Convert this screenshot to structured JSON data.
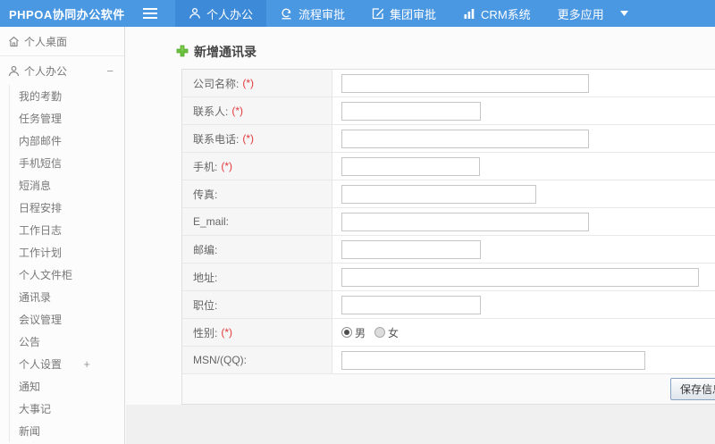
{
  "app": {
    "title": "PHPOA协同办公软件"
  },
  "header": {
    "hamburger_icon": "menu-icon",
    "nav": [
      {
        "label": "个人办公",
        "icon": "person-icon",
        "active": true
      },
      {
        "label": "流程审批",
        "icon": "process-icon",
        "active": false
      },
      {
        "label": "集团审批",
        "icon": "edit-icon",
        "active": false
      },
      {
        "label": "CRM系统",
        "icon": "chart-icon",
        "active": false
      },
      {
        "label": "更多应用",
        "icon": "caret-down-icon",
        "active": false,
        "caret": true
      }
    ]
  },
  "sidebar": {
    "desktop_item": {
      "label": "个人桌面",
      "icon": "home-icon"
    },
    "group_item": {
      "label": "个人办公",
      "icon": "person-icon",
      "collapse_symbol": "−"
    },
    "sub_items": [
      "我的考勤",
      "任务管理",
      "内部邮件",
      "手机短信",
      "短消息",
      "日程安排",
      "工作日志",
      "工作计划",
      "个人文件柜",
      "通讯录",
      "会议管理",
      "公告"
    ],
    "settings_item": {
      "label": "个人设置",
      "expand_symbol": "+"
    },
    "extra_items": [
      "通知",
      "大事记",
      "新闻"
    ]
  },
  "main": {
    "title": "新增通讯录",
    "title_icon": "plus-icon",
    "required_mark": "(*)",
    "form_rows": [
      {
        "label": "公司名称:",
        "required": true,
        "type": "text",
        "input_width": 277
      },
      {
        "label": "联系人:",
        "required": true,
        "type": "text",
        "input_width": 156
      },
      {
        "label": "联系电话:",
        "required": true,
        "type": "text",
        "input_width": 277
      },
      {
        "label": "手机:",
        "required": true,
        "type": "text",
        "input_width": 155
      },
      {
        "label": "传真:",
        "required": false,
        "type": "text",
        "input_width": 218
      },
      {
        "label": "E_mail:",
        "required": false,
        "type": "text",
        "input_width": 277
      },
      {
        "label": "邮编:",
        "required": false,
        "type": "text",
        "input_width": 156
      },
      {
        "label": "地址:",
        "required": false,
        "type": "text",
        "input_width": 400
      },
      {
        "label": "职位:",
        "required": false,
        "type": "text",
        "input_width": 156
      },
      {
        "label": "性别:",
        "required": true,
        "type": "radio",
        "options": [
          {
            "label": "男",
            "checked": true
          },
          {
            "label": "女",
            "checked": false
          }
        ]
      },
      {
        "label": "MSN/(QQ):",
        "required": false,
        "type": "text",
        "input_width": 340
      }
    ],
    "save_label": "保存信息"
  },
  "colors": {
    "header_bg": "#4a97e2",
    "header_active_bg": "#3c8ad8",
    "accent_green": "#6abf3f",
    "required_red": "#e4393c",
    "label_cell_bg": "#f6f6f6"
  }
}
